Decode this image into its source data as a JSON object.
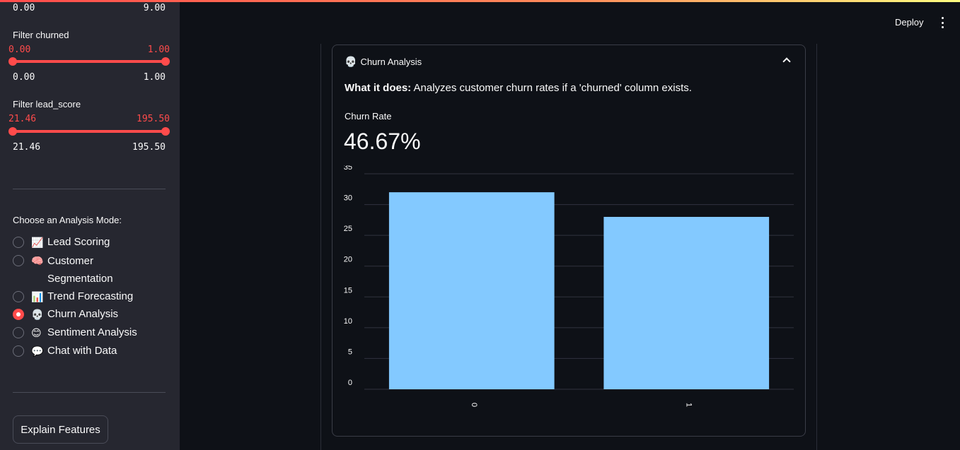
{
  "sidebar": {
    "top_range": {
      "min": "0.00",
      "max": "9.00"
    },
    "filters": [
      {
        "label": "Filter churned",
        "sel_min": "0.00",
        "sel_max": "1.00",
        "min": "0.00",
        "max": "1.00"
      },
      {
        "label": "Filter lead_score",
        "sel_min": "21.46",
        "sel_max": "195.50",
        "min": "21.46",
        "max": "195.50"
      }
    ],
    "mode_title": "Choose an Analysis Mode:",
    "modes": [
      {
        "emoji": "📈",
        "label": "Lead Scoring"
      },
      {
        "emoji": "🧠",
        "label": "Customer Segmentation"
      },
      {
        "emoji": "📊",
        "label": "Trend Forecasting"
      },
      {
        "emoji": "💀",
        "label": "Churn Analysis"
      },
      {
        "emoji": "😊",
        "label": "Sentiment Analysis"
      },
      {
        "emoji": "💬",
        "label": "Chat with Data"
      }
    ],
    "selected_mode": 3,
    "explain_button": "Explain Features"
  },
  "header": {
    "deploy": "Deploy",
    "menu_icon": "kebab-menu-icon"
  },
  "expander": {
    "emoji": "💀",
    "title": "Churn Analysis",
    "desc_bold": "What it does:",
    "desc_text": " Analyzes customer churn rates if a 'churned' column exists.",
    "metric_label": "Churn Rate",
    "metric_value": "46.67%"
  },
  "colors": {
    "accent": "#ff4b4b",
    "bar": "#83c9ff",
    "background": "#0e1117",
    "sidebar": "#262730"
  },
  "chart_data": {
    "type": "bar",
    "categories": [
      "0",
      "1"
    ],
    "values": [
      32,
      28
    ],
    "ylim": [
      0,
      35
    ],
    "yticks": [
      0,
      5,
      10,
      15,
      20,
      25,
      30,
      35
    ],
    "grid": true,
    "title": "",
    "xlabel": "",
    "ylabel": ""
  }
}
